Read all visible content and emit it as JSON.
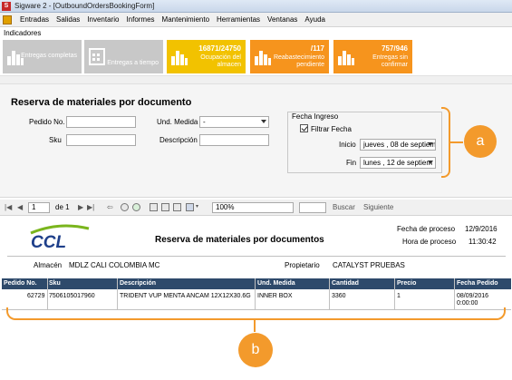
{
  "window": {
    "app_title": "Sigware 2 - [OutboundOrdersBookingForm]",
    "app_icon": "S"
  },
  "menu": {
    "items": [
      "Entradas",
      "Salidas",
      "Inventario",
      "Informes",
      "Mantenimiento",
      "Herramientas",
      "Ventanas",
      "Ayuda"
    ]
  },
  "indicators": {
    "label": "Indicadores",
    "tiles": [
      {
        "value": "",
        "label": "Entregas completas",
        "color": "#c8c8c8",
        "icon": "bar-chart-icon"
      },
      {
        "value": "",
        "label": "Entregas a tiempo",
        "color": "#c8c8c8",
        "icon": "calendar-icon"
      },
      {
        "value": "16871/24750",
        "label": "Ocupación del almacen",
        "color": "#f2c200",
        "icon": "bar-chart-icon"
      },
      {
        "value": "/117",
        "label": "Reabastecimiento pendiente",
        "color": "#f6941d",
        "icon": "bar-chart-icon"
      },
      {
        "value": "757/946",
        "label": "Entregas sin confirmar",
        "color": "#f6941d",
        "icon": "bar-chart-icon"
      }
    ]
  },
  "form": {
    "title": "Reserva de materiales por documento",
    "pedido_label": "Pedido No.",
    "pedido_value": "",
    "sku_label": "Sku",
    "sku_value": "",
    "und_label": "Und. Medida",
    "und_value": "-",
    "desc_label": "Descripción",
    "desc_value": "",
    "fecha_group": "Fecha Ingreso",
    "filtrar_label": "Filtrar Fecha",
    "filtrar_checked": true,
    "inicio_label": "Inicio",
    "inicio_value": "jueves , 08 de septiem",
    "fin_label": "Fin",
    "fin_value": "lunes , 12 de septiem"
  },
  "callouts": {
    "a": "a",
    "b": "b",
    "accent": "#f39a2c"
  },
  "toolbar": {
    "page_current": "1",
    "page_of": "de 1",
    "zoom": "100%",
    "search_label": "Buscar",
    "next_label": "Siguiente"
  },
  "report": {
    "logo_text": "CCL",
    "title": "Reserva de materiales por documentos",
    "fecha_proceso_label": "Fecha de proceso",
    "fecha_proceso_value": "12/9/2016",
    "hora_proceso_label": "Hora de proceso",
    "hora_proceso_value": "11:30:42",
    "almacen_label": "Almacén",
    "almacen_value": "MDLZ CALI COLOMBIA MC",
    "propietario_label": "Propietario",
    "propietario_value": "CATALYST PRUEBAS",
    "columns": [
      "Pedido No.",
      "Sku",
      "Descripción",
      "Und. Medida",
      "Cantidad",
      "Precio",
      "Fecha Pedido"
    ],
    "rows": [
      {
        "pedido": "62729",
        "sku": "7506105017960",
        "descripcion": "TRIDENT VUP MENTA ANCAM 12X12X30.6G",
        "und": "INNER BOX",
        "cantidad": "3360",
        "precio": "1",
        "fecha_line1": "08/09/2016",
        "fecha_line2": "0:00:00"
      }
    ],
    "header_color": "#2e4a6b"
  }
}
